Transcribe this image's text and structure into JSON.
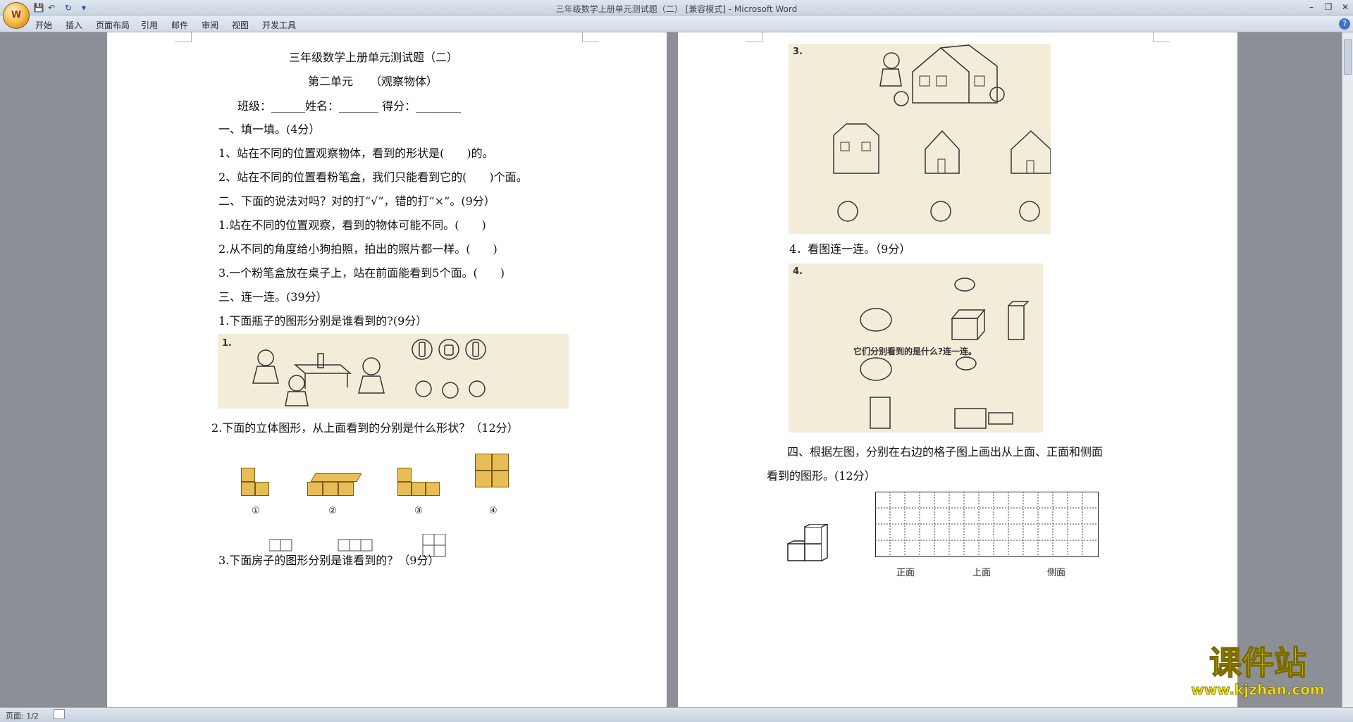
{
  "window": {
    "title": "三年级数学上册单元测试题（二） [兼容模式] - Microsoft Word"
  },
  "ribbon": {
    "tabs": [
      "开始",
      "插入",
      "页面布局",
      "引用",
      "邮件",
      "审阅",
      "视图",
      "开发工具"
    ]
  },
  "page1": {
    "title": "三年级数学上册单元测试题（二）",
    "subtitle": "第二单元　　（观察物体）",
    "info": "班级：______姓名：_______ 得分：________",
    "q1": "一、填一填。(4分）",
    "q1_1": "1、站在不同的位置观察物体，看到的形状是(　　)的。",
    "q1_2": "2、站在不同的位置看粉笔盒，我们只能看到它的(　　)个面。",
    "q2": "二、下面的说法对吗？对的打“√”，错的打“×”。(9分）",
    "q2_1": "1.站在不同的位置观察，看到的物体可能不同。(　　)",
    "q2_2": "2.从不同的角度给小狗拍照，拍出的照片都一样。(　　)",
    "q2_3": "3.一个粉笔盒放在桌子上，站在前面能看到5个面。(　　)",
    "q3": "三、连一连。(39分）",
    "q3_1": "1.下面瓶子的图形分别是谁看到的?(9分）",
    "img1_num": "1.",
    "q3_2": "2.下面的立体图形，从上面看到的分别是什么形状？（12分）",
    "shape_labels": [
      "①",
      "②",
      "③",
      "④"
    ],
    "q3_3": "3.下面房子的图形分别是谁看到的？（9分）"
  },
  "page2": {
    "img3_num": "3.",
    "q4": "4．看图连一连。（9分）",
    "img4_num": "4.",
    "img4_caption": "它们分别看到的是什么?连一连。",
    "q5a": "四、根据左图，分别在右边的格子图上画出从上面、正面和侧面",
    "q5b": "看到的图形。(12分）",
    "grid_labels": [
      "正面",
      "上面",
      "侧面"
    ]
  },
  "status": {
    "page": "页面: 1/2"
  },
  "watermark": {
    "brand": "课件站",
    "url": "www.kjzhan.com"
  },
  "colors": {
    "page_bg": "#ffffff",
    "workspace": "#8c8f95",
    "photo_bg": "#f3ecd9",
    "cube": "#e8bd55",
    "logo_yellow": "#f2e21c"
  }
}
